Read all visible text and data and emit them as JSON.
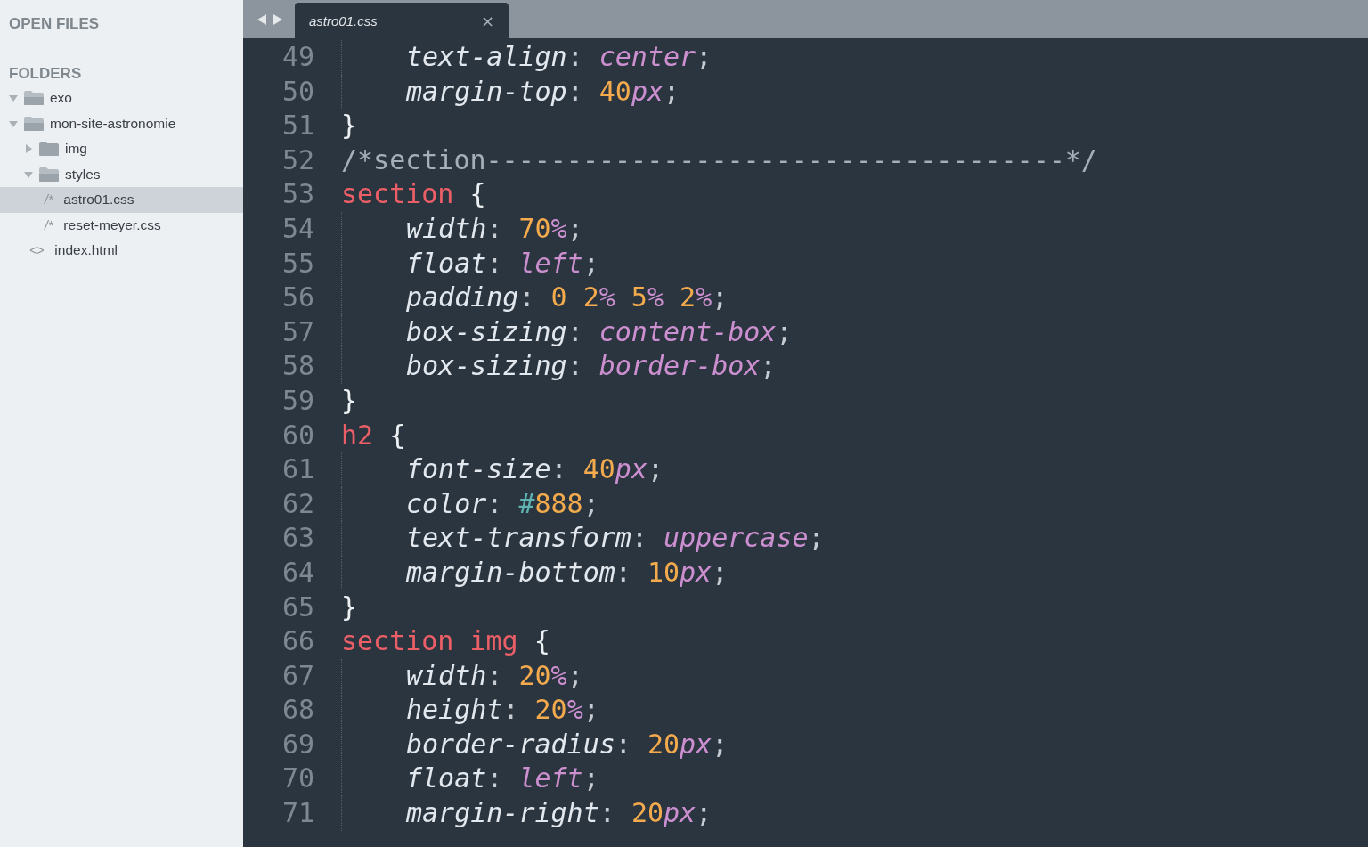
{
  "sidebar": {
    "open_files_heading": "OPEN FILES",
    "folders_heading": "FOLDERS",
    "tree": [
      {
        "kind": "folder",
        "label": "exo",
        "expanded": true,
        "selected": false
      },
      {
        "kind": "folder",
        "label": "mon-site-astronomie",
        "expanded": true,
        "selected": false,
        "children": [
          {
            "kind": "folder",
            "label": "img",
            "expanded": false,
            "selected": false
          },
          {
            "kind": "folder",
            "label": "styles",
            "expanded": true,
            "selected": false,
            "children": [
              {
                "kind": "file",
                "glyph": "/*",
                "label": "astro01.css",
                "selected": true
              },
              {
                "kind": "file",
                "glyph": "/*",
                "label": "reset-meyer.css",
                "selected": false
              }
            ]
          },
          {
            "kind": "file",
            "glyph": "<>",
            "label": "index.html",
            "selected": false
          }
        ]
      }
    ]
  },
  "tabs": [
    {
      "label": "astro01.css",
      "selected": true,
      "close": "×"
    }
  ],
  "editor": {
    "lines": [
      {
        "number": "49",
        "indented": true,
        "tokens": [
          {
            "kind": "property",
            "text": "text-align"
          },
          {
            "kind": "punct",
            "text": ": "
          },
          {
            "kind": "keyword",
            "text": "center"
          },
          {
            "kind": "punct",
            "text": ";"
          }
        ]
      },
      {
        "number": "50",
        "indented": true,
        "tokens": [
          {
            "kind": "property",
            "text": "margin-top"
          },
          {
            "kind": "punct",
            "text": ": "
          },
          {
            "kind": "number",
            "text": "40"
          },
          {
            "kind": "unit",
            "text": "px"
          },
          {
            "kind": "punct",
            "text": ";"
          }
        ]
      },
      {
        "number": "51",
        "indented": false,
        "tokens": [
          {
            "kind": "brace",
            "text": "}"
          }
        ]
      },
      {
        "number": "52",
        "indented": false,
        "tokens": [
          {
            "kind": "comment",
            "text": "/*section------------------------------------*/"
          }
        ]
      },
      {
        "number": "53",
        "indented": false,
        "tokens": [
          {
            "kind": "selector",
            "text": "section"
          },
          {
            "kind": "brace",
            "text": " {"
          }
        ]
      },
      {
        "number": "54",
        "indented": true,
        "tokens": [
          {
            "kind": "property",
            "text": "width"
          },
          {
            "kind": "punct",
            "text": ": "
          },
          {
            "kind": "number",
            "text": "70"
          },
          {
            "kind": "unit",
            "text": "%"
          },
          {
            "kind": "punct",
            "text": ";"
          }
        ]
      },
      {
        "number": "55",
        "indented": true,
        "tokens": [
          {
            "kind": "property",
            "text": "float"
          },
          {
            "kind": "punct",
            "text": ": "
          },
          {
            "kind": "keyword",
            "text": "left"
          },
          {
            "kind": "punct",
            "text": ";"
          }
        ]
      },
      {
        "number": "56",
        "indented": true,
        "tokens": [
          {
            "kind": "property",
            "text": "padding"
          },
          {
            "kind": "punct",
            "text": ": "
          },
          {
            "kind": "number",
            "text": "0 2"
          },
          {
            "kind": "unit",
            "text": "%"
          },
          {
            "kind": "number",
            "text": " 5"
          },
          {
            "kind": "unit",
            "text": "%"
          },
          {
            "kind": "number",
            "text": " 2"
          },
          {
            "kind": "unit",
            "text": "%"
          },
          {
            "kind": "punct",
            "text": ";"
          }
        ]
      },
      {
        "number": "57",
        "indented": true,
        "tokens": [
          {
            "kind": "property",
            "text": "box-sizing"
          },
          {
            "kind": "punct",
            "text": ": "
          },
          {
            "kind": "keyword",
            "text": "content-box"
          },
          {
            "kind": "punct",
            "text": ";"
          }
        ]
      },
      {
        "number": "58",
        "indented": true,
        "tokens": [
          {
            "kind": "property",
            "text": "box-sizing"
          },
          {
            "kind": "punct",
            "text": ": "
          },
          {
            "kind": "keyword",
            "text": "border-box"
          },
          {
            "kind": "punct",
            "text": ";"
          }
        ]
      },
      {
        "number": "59",
        "indented": false,
        "tokens": [
          {
            "kind": "brace",
            "text": "}"
          }
        ]
      },
      {
        "number": "60",
        "indented": false,
        "tokens": [
          {
            "kind": "selector",
            "text": "h2"
          },
          {
            "kind": "brace",
            "text": " {"
          }
        ]
      },
      {
        "number": "61",
        "indented": true,
        "tokens": [
          {
            "kind": "property",
            "text": "font-size"
          },
          {
            "kind": "punct",
            "text": ": "
          },
          {
            "kind": "number",
            "text": "40"
          },
          {
            "kind": "unit",
            "text": "px"
          },
          {
            "kind": "punct",
            "text": ";"
          }
        ]
      },
      {
        "number": "62",
        "indented": true,
        "tokens": [
          {
            "kind": "property",
            "text": "color"
          },
          {
            "kind": "punct",
            "text": ": "
          },
          {
            "kind": "hash",
            "text": "#"
          },
          {
            "kind": "number",
            "text": "888"
          },
          {
            "kind": "punct",
            "text": ";"
          }
        ]
      },
      {
        "number": "63",
        "indented": true,
        "tokens": [
          {
            "kind": "property",
            "text": "text-transform"
          },
          {
            "kind": "punct",
            "text": ": "
          },
          {
            "kind": "keyword",
            "text": "uppercase"
          },
          {
            "kind": "punct",
            "text": ";"
          }
        ]
      },
      {
        "number": "64",
        "indented": true,
        "tokens": [
          {
            "kind": "property",
            "text": "margin-bottom"
          },
          {
            "kind": "punct",
            "text": ": "
          },
          {
            "kind": "number",
            "text": "10"
          },
          {
            "kind": "unit",
            "text": "px"
          },
          {
            "kind": "punct",
            "text": ";"
          }
        ]
      },
      {
        "number": "65",
        "indented": false,
        "tokens": [
          {
            "kind": "brace",
            "text": "}"
          }
        ]
      },
      {
        "number": "66",
        "indented": false,
        "tokens": [
          {
            "kind": "selector",
            "text": "section img"
          },
          {
            "kind": "brace",
            "text": " {"
          }
        ]
      },
      {
        "number": "67",
        "indented": true,
        "tokens": [
          {
            "kind": "property",
            "text": "width"
          },
          {
            "kind": "punct",
            "text": ": "
          },
          {
            "kind": "number",
            "text": "20"
          },
          {
            "kind": "unit",
            "text": "%"
          },
          {
            "kind": "punct",
            "text": ";"
          }
        ]
      },
      {
        "number": "68",
        "indented": true,
        "tokens": [
          {
            "kind": "property",
            "text": "height"
          },
          {
            "kind": "punct",
            "text": ": "
          },
          {
            "kind": "number",
            "text": "20"
          },
          {
            "kind": "unit",
            "text": "%"
          },
          {
            "kind": "punct",
            "text": ";"
          }
        ]
      },
      {
        "number": "69",
        "indented": true,
        "tokens": [
          {
            "kind": "property",
            "text": "border-radius"
          },
          {
            "kind": "punct",
            "text": ": "
          },
          {
            "kind": "number",
            "text": "20"
          },
          {
            "kind": "unit",
            "text": "px"
          },
          {
            "kind": "punct",
            "text": ";"
          }
        ]
      },
      {
        "number": "70",
        "indented": true,
        "tokens": [
          {
            "kind": "property",
            "text": "float"
          },
          {
            "kind": "punct",
            "text": ": "
          },
          {
            "kind": "keyword",
            "text": "left"
          },
          {
            "kind": "punct",
            "text": ";"
          }
        ]
      },
      {
        "number": "71",
        "indented": true,
        "tokens": [
          {
            "kind": "property",
            "text": "margin-right"
          },
          {
            "kind": "punct",
            "text": ": "
          },
          {
            "kind": "number",
            "text": "20"
          },
          {
            "kind": "unit",
            "text": "px"
          },
          {
            "kind": "punct",
            "text": ";"
          }
        ]
      }
    ]
  }
}
